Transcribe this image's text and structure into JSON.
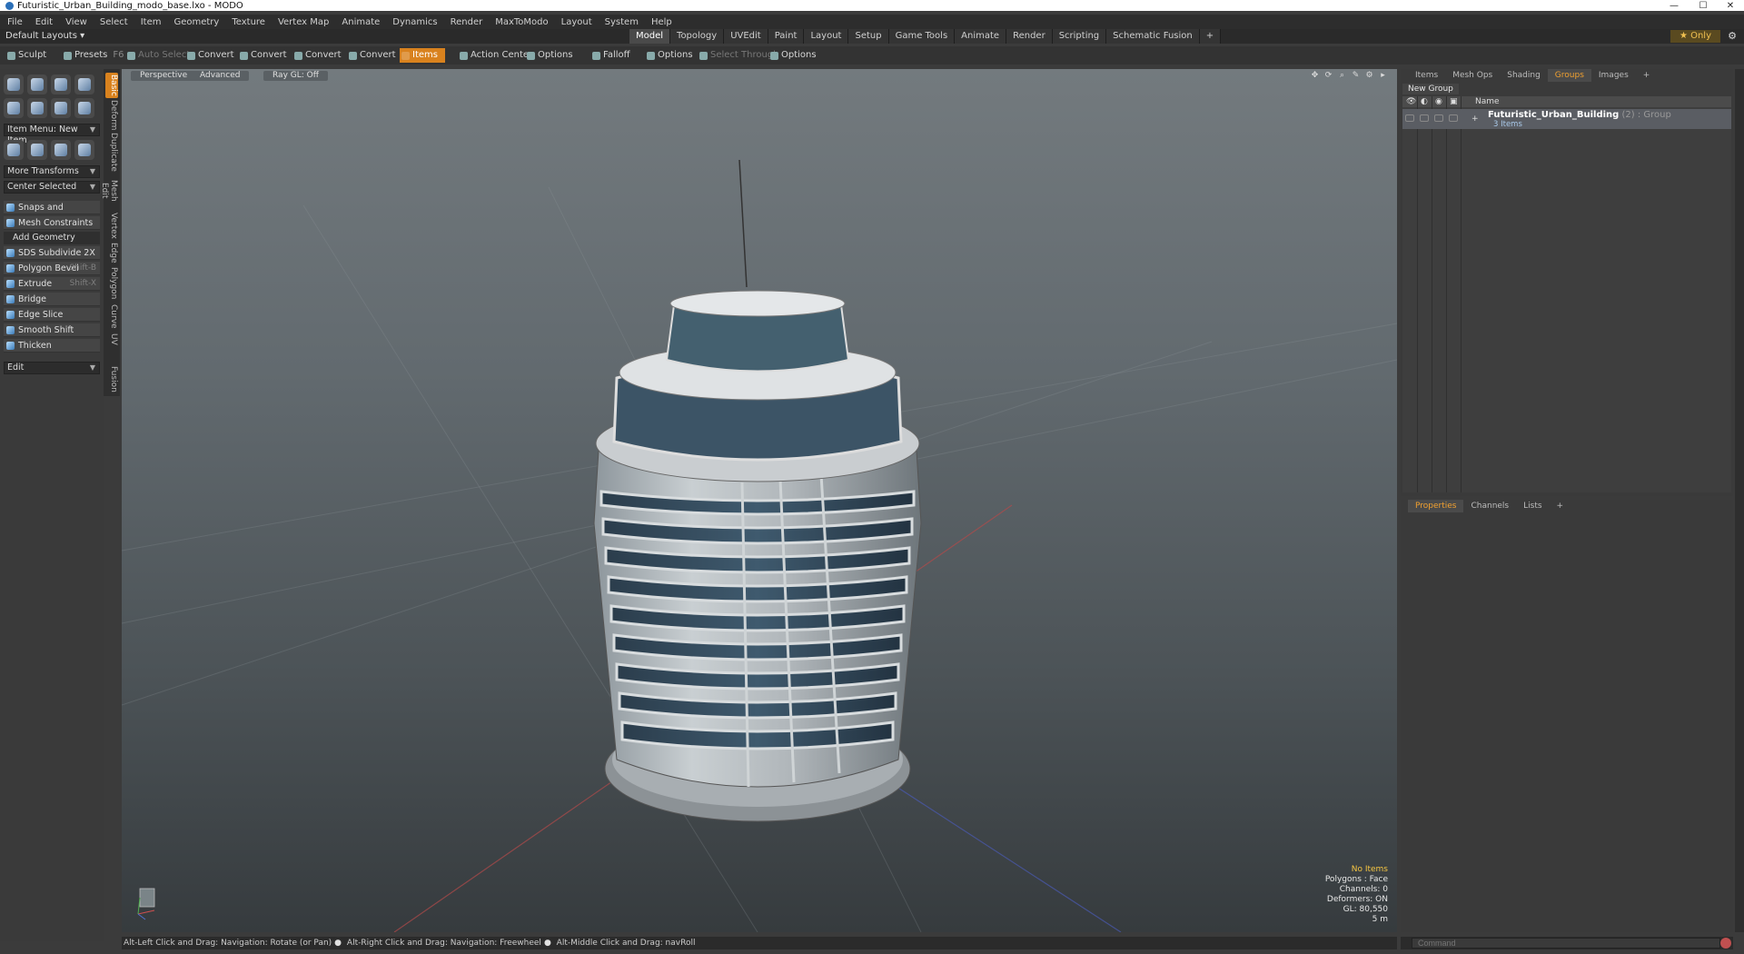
{
  "window": {
    "title": "Futuristic_Urban_Building_modo_base.lxo - MODO",
    "minimize": "—",
    "maximize": "☐",
    "close": "✕"
  },
  "menu": [
    "File",
    "Edit",
    "View",
    "Select",
    "Item",
    "Geometry",
    "Texture",
    "Vertex Map",
    "Animate",
    "Dynamics",
    "Render",
    "MaxToModo",
    "Layout",
    "System",
    "Help"
  ],
  "layouts": {
    "label": "Default Layouts ▾"
  },
  "layout_tabs": [
    {
      "label": "Model",
      "active": true
    },
    {
      "label": "Topology"
    },
    {
      "label": "UVEdit"
    },
    {
      "label": "Paint"
    },
    {
      "label": "Layout"
    },
    {
      "label": "Setup"
    },
    {
      "label": "Game Tools"
    },
    {
      "label": "Animate"
    },
    {
      "label": "Render"
    },
    {
      "label": "Scripting"
    },
    {
      "label": "Schematic Fusion"
    },
    {
      "label": "+"
    }
  ],
  "only_button": "★ Only",
  "toolbar": {
    "sculpt": "Sculpt",
    "presets": "Presets",
    "presets_key": "F6",
    "auto_select": "Auto Select",
    "convert1": "Convert",
    "convert2": "Convert",
    "convert3": "Convert",
    "convert4": "Convert",
    "items": "Items",
    "action_center": "Action Center",
    "options1": "Options",
    "falloff": "Falloff",
    "options2": "Options",
    "select_through": "Select Through",
    "options3": "Options"
  },
  "left_panel": {
    "item_menu": "Item Menu: New Item",
    "more_transforms": "More Transforms",
    "center_selected": "Center Selected",
    "snaps": "Snaps and Precision",
    "mesh_constraints": "Mesh Constraints",
    "add_geometry": "Add Geometry",
    "tools": [
      {
        "label": "SDS Subdivide 2X",
        "shortcut": ""
      },
      {
        "label": "Polygon Bevel",
        "shortcut": "Shift-B"
      },
      {
        "label": "Extrude",
        "shortcut": "Shift-X"
      },
      {
        "label": "Bridge",
        "shortcut": ""
      },
      {
        "label": "Edge Slice",
        "shortcut": ""
      },
      {
        "label": "Smooth Shift",
        "shortcut": ""
      },
      {
        "label": "Thicken",
        "shortcut": ""
      }
    ],
    "edit_dropdown": "Edit",
    "vtabs": [
      "Basic",
      "Deform",
      "Duplicate",
      "Mesh Edit",
      "Vertex",
      "Edge",
      "Polygon",
      "Curve",
      "UV",
      "Fusion"
    ]
  },
  "viewport": {
    "perspective": "Perspective",
    "advanced": "Advanced",
    "raygl": "Ray GL: Off",
    "info": {
      "selection": "No Items",
      "polygons": "Polygons : Face",
      "channels": "Channels: 0",
      "deformers": "Deformers: ON",
      "gl": "GL: 80,550",
      "scale": "5 m"
    }
  },
  "status": {
    "hint1": "Alt-Left Click and Drag: Navigation: Rotate (or Pan)",
    "hint2": "Alt-Right Click and Drag: Navigation: Freewheel",
    "hint3": "Alt-Middle Click and Drag: navRoll"
  },
  "right_top": {
    "tabs": [
      {
        "label": "Items"
      },
      {
        "label": "Mesh Ops"
      },
      {
        "label": "Shading"
      },
      {
        "label": "Groups",
        "active": true
      },
      {
        "label": "Images"
      },
      {
        "label": "+"
      }
    ],
    "new_group": "New Group",
    "col_name": "Name",
    "group": {
      "name": "Futuristic_Urban_Building",
      "suffix": " (2) : Group",
      "count": "3 Items"
    }
  },
  "right_bottom": {
    "tabs": [
      {
        "label": "Properties",
        "active": true
      },
      {
        "label": "Channels"
      },
      {
        "label": "Lists"
      },
      {
        "label": "+"
      }
    ]
  },
  "command": {
    "placeholder": "Command"
  }
}
